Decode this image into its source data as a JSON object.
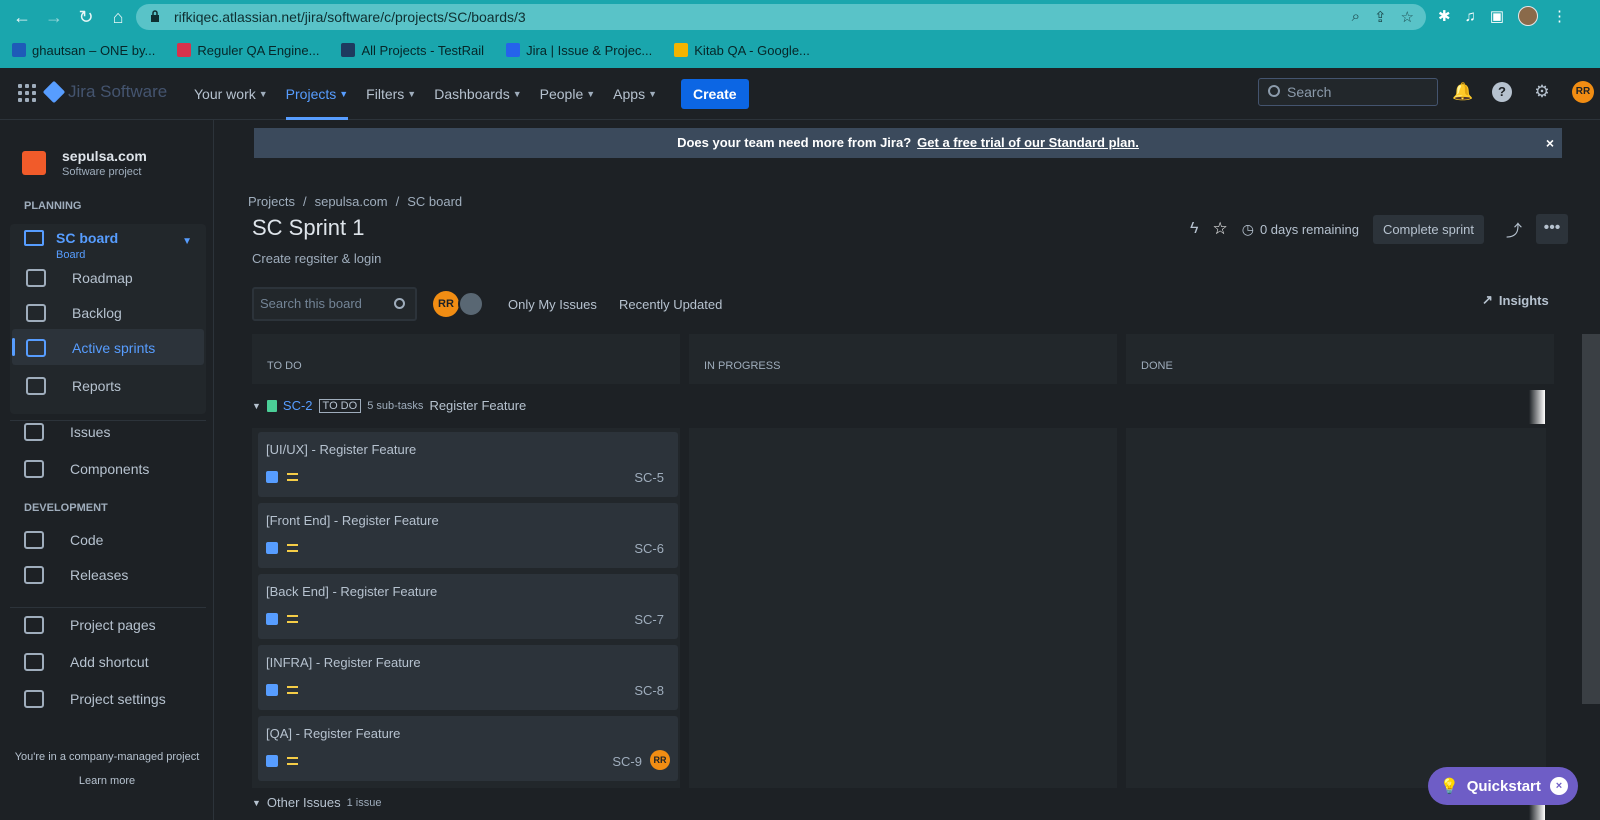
{
  "browser": {
    "url": "rifkiqec.atlassian.net/jira/software/c/projects/SC/boards/3",
    "bookmarks": [
      {
        "label": "ghautsan – ONE by...",
        "color": "#1e5bb8"
      },
      {
        "label": "Reguler QA Engine...",
        "color": "#d8324c"
      },
      {
        "label": "All Projects - TestRail",
        "color": "#1e3a5f"
      },
      {
        "label": "Jira | Issue & Projec...",
        "color": "#2563eb"
      },
      {
        "label": "Kitab QA - Google...",
        "color": "#f4b400"
      }
    ]
  },
  "topnav": {
    "logo": "Jira Software",
    "menu": [
      "Your work",
      "Projects",
      "Filters",
      "Dashboards",
      "People",
      "Apps"
    ],
    "create": "Create",
    "search_placeholder": "Search",
    "avatar": "RR"
  },
  "sidebar": {
    "project_name": "sepulsa.com",
    "project_type": "Software project",
    "planning": "PLANNING",
    "board_title": "SC board",
    "board_sub": "Board",
    "planning_items": [
      "Roadmap",
      "Backlog",
      "Active sprints",
      "Reports"
    ],
    "items2": [
      "Issues",
      "Components"
    ],
    "development": "DEVELOPMENT",
    "dev_items": [
      "Code",
      "Releases"
    ],
    "bottom_items": [
      "Project pages",
      "Add shortcut",
      "Project settings"
    ],
    "company_note": "You're in a company-managed project",
    "learn_more": "Learn more"
  },
  "banner": {
    "text": "Does your team need more from Jira?",
    "link": "Get a free trial of our Standard plan.",
    "close": "×"
  },
  "breadcrumb": [
    "Projects",
    "sepulsa.com",
    "SC board"
  ],
  "sprint": {
    "title": "SC Sprint 1",
    "goal": "Create regsiter & login",
    "remaining": "0 days remaining",
    "complete": "Complete sprint",
    "more": "•••"
  },
  "filters": {
    "search_placeholder": "Search this board",
    "avatar": "RR",
    "only_my": "Only My Issues",
    "recent": "Recently Updated",
    "insights": "Insights"
  },
  "columns": [
    "TO DO",
    "IN PROGRESS",
    "DONE"
  ],
  "swimlane": {
    "key": "SC-2",
    "status": "TO DO",
    "count": "5 sub-tasks",
    "title": "Register Feature"
  },
  "cards": [
    {
      "title": "[UI/UX] - Register Feature",
      "key": "SC-5"
    },
    {
      "title": "[Front End] - Register Feature",
      "key": "SC-6"
    },
    {
      "title": "[Back End] - Register Feature",
      "key": "SC-7"
    },
    {
      "title": "[INFRA] - Register Feature",
      "key": "SC-8"
    },
    {
      "title": "[QA] - Register Feature",
      "key": "SC-9",
      "assignee": "RR"
    }
  ],
  "other": {
    "label": "Other Issues",
    "count": "1 issue"
  },
  "quickstart": {
    "label": "Quickstart",
    "close": "×"
  }
}
